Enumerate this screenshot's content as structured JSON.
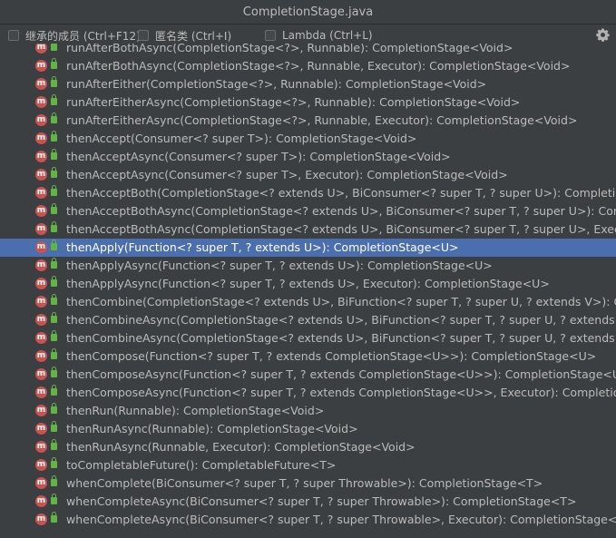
{
  "window": {
    "title": "CompletionStage.java"
  },
  "toolbar": {
    "inherited_label": "继承的成员 (Ctrl+F12)",
    "anonymous_label": "匿名类 (Ctrl+I)",
    "lambda_label": "Lambda (Ctrl+L)",
    "settings_icon": "gear-icon"
  },
  "colors": {
    "background": "#3c3f41",
    "selection": "#4b6eaf",
    "method_icon": "#c75450",
    "public_lock": "#62b543"
  },
  "members": [
    {
      "signature": "runAfterBothAsync(CompletionStage<?>, Runnable): CompletionStage<Void>"
    },
    {
      "signature": "runAfterBothAsync(CompletionStage<?>, Runnable, Executor): CompletionStage<Void>"
    },
    {
      "signature": "runAfterEither(CompletionStage<?>, Runnable): CompletionStage<Void>"
    },
    {
      "signature": "runAfterEitherAsync(CompletionStage<?>, Runnable): CompletionStage<Void>"
    },
    {
      "signature": "runAfterEitherAsync(CompletionStage<?>, Runnable, Executor): CompletionStage<Void>"
    },
    {
      "signature": "thenAccept(Consumer<? super T>): CompletionStage<Void>"
    },
    {
      "signature": "thenAcceptAsync(Consumer<? super T>): CompletionStage<Void>"
    },
    {
      "signature": "thenAcceptAsync(Consumer<? super T>, Executor): CompletionStage<Void>"
    },
    {
      "signature": "thenAcceptBoth(CompletionStage<? extends U>, BiConsumer<? super T, ? super U>): CompletionStage"
    },
    {
      "signature": "thenAcceptBothAsync(CompletionStage<? extends U>, BiConsumer<? super T, ? super U>): Completion"
    },
    {
      "signature": "thenAcceptBothAsync(CompletionStage<? extends U>, BiConsumer<? super T, ? super U>, Executor): C"
    },
    {
      "signature": "thenApply(Function<? super T, ? extends U>): CompletionStage<U>",
      "selected": true
    },
    {
      "signature": "thenApplyAsync(Function<? super T, ? extends U>): CompletionStage<U>"
    },
    {
      "signature": "thenApplyAsync(Function<? super T, ? extends U>, Executor): CompletionStage<U>"
    },
    {
      "signature": "thenCombine(CompletionStage<? extends U>, BiFunction<? super T, ? super U, ? extends V>): Complet"
    },
    {
      "signature": "thenCombineAsync(CompletionStage<? extends U>, BiFunction<? super T, ? super U, ? extends V>): Co"
    },
    {
      "signature": "thenCombineAsync(CompletionStage<? extends U>, BiFunction<? super T, ? super U, ? extends V>, Exe"
    },
    {
      "signature": "thenCompose(Function<? super T, ? extends CompletionStage<U>>): CompletionStage<U>"
    },
    {
      "signature": "thenComposeAsync(Function<? super T, ? extends CompletionStage<U>>): CompletionStage<U>"
    },
    {
      "signature": "thenComposeAsync(Function<? super T, ? extends CompletionStage<U>>, Executor): CompletionStage<"
    },
    {
      "signature": "thenRun(Runnable): CompletionStage<Void>"
    },
    {
      "signature": "thenRunAsync(Runnable): CompletionStage<Void>"
    },
    {
      "signature": "thenRunAsync(Runnable, Executor): CompletionStage<Void>"
    },
    {
      "signature": "toCompletableFuture(): CompletableFuture<T>"
    },
    {
      "signature": "whenComplete(BiConsumer<? super T, ? super Throwable>): CompletionStage<T>"
    },
    {
      "signature": "whenCompleteAsync(BiConsumer<? super T, ? super Throwable>): CompletionStage<T>"
    },
    {
      "signature": "whenCompleteAsync(BiConsumer<? super T, ? super Throwable>, Executor): CompletionStage<T>"
    }
  ]
}
